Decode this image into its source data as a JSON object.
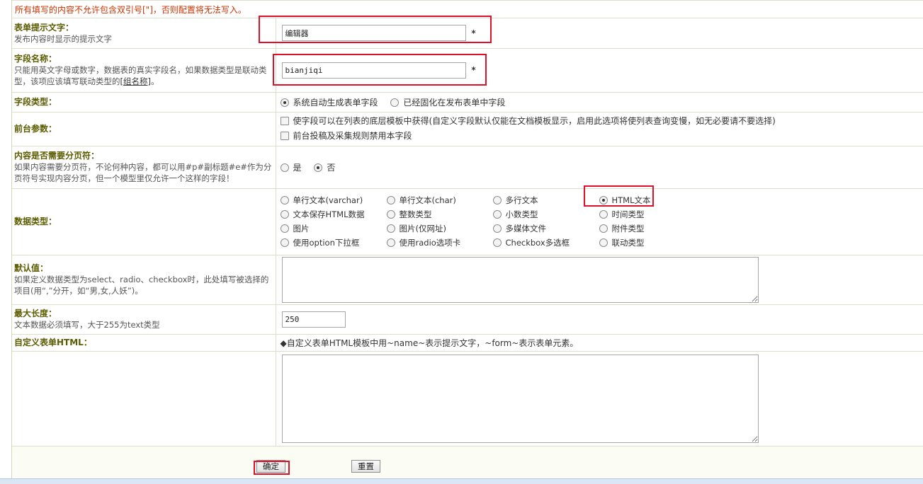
{
  "notice": "所有填写的内容不允许包含双引号[\"]，否则配置将无法写入。",
  "rows": {
    "prompt": {
      "title": "表单提示文字：",
      "desc": "发布内容时显示的提示文字",
      "value": "编辑器",
      "required": "*"
    },
    "fieldname": {
      "title": "字段名称：",
      "desc": "只能用英文字母或数字，数据表的真实字段名，如果数据类型是联动类型，该项应该填写联动类型的",
      "desc_link": "[组名称]",
      "desc_tail": "。",
      "value": "bianjiqi",
      "required": "*"
    },
    "fieldtype": {
      "title": "字段类型：",
      "options": [
        "系统自动生成表单字段",
        "已经固化在发布表单中字段"
      ],
      "selected": 0
    },
    "frontend": {
      "title": "前台参数：",
      "check1": "使字段可以在列表的底层模板中获得(自定义字段默认仅能在文档模板显示，启用此选项将使列表查询变慢，如无必要请不要选择)",
      "check2": "前台投稿及采集规则禁用本字段"
    },
    "paging": {
      "title": "内容是否需要分页符：",
      "desc": "如果内容需要分页符，不论何种内容，都可以用#p#副标题#e#作为分页符号实现内容分页，但一个模型里仅允许一个这样的字段！",
      "options": [
        "是",
        "否"
      ],
      "selected": 1
    },
    "datatype": {
      "title": "数据类型：",
      "options": [
        "单行文本(varchar)",
        "单行文本(char)",
        "多行文本",
        "HTML文本",
        "文本保存HTML数据",
        "整数类型",
        "小数类型",
        "时间类型",
        "图片",
        "图片(仅网址)",
        "多媒体文件",
        "附件类型",
        "使用option下拉框",
        "使用radio选项卡",
        "Checkbox多选框",
        "联动类型"
      ],
      "selected": 3
    },
    "default": {
      "title": "默认值：",
      "desc": "如果定义数据类型为select、radio、checkbox时，此处填写被选择的项目(用“,”分开，如“男,女,人妖”)。"
    },
    "maxlen": {
      "title": "最大长度：",
      "desc": "文本数据必须填写，大于255为text类型",
      "value": "250"
    },
    "customhtml": {
      "title": "自定义表单HTML：",
      "hint": "◆自定义表单HTML模板中用~name~表示提示文字，~form~表示表单元素。"
    }
  },
  "buttons": {
    "submit": "确定",
    "reset": "重置"
  },
  "colors": {
    "highlight": "#e0102a",
    "notice": "#cc3300",
    "label": "#5b5b00"
  }
}
